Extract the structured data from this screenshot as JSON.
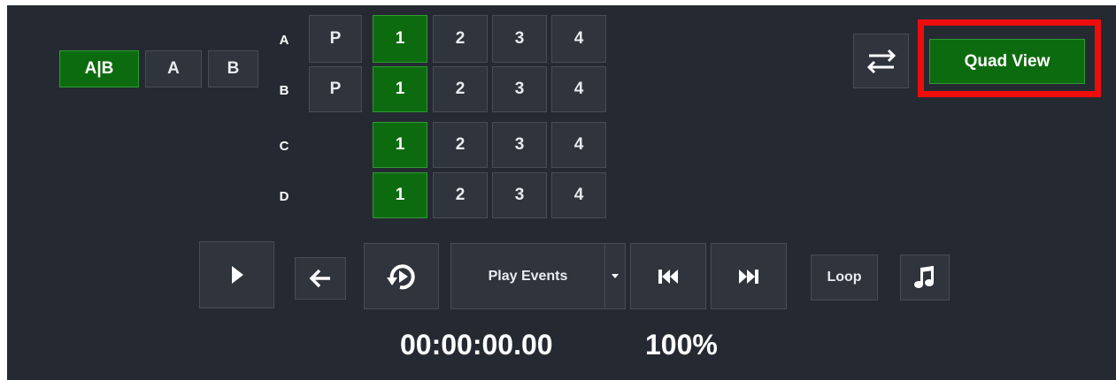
{
  "view_mode": {
    "items": [
      {
        "label": "A|B",
        "active": true
      },
      {
        "label": "A",
        "active": false
      },
      {
        "label": "B",
        "active": false
      }
    ]
  },
  "channels": {
    "rows": [
      {
        "label": "A",
        "preview": "P",
        "slots": [
          "1",
          "2",
          "3",
          "4"
        ],
        "active_slot": "1"
      },
      {
        "label": "B",
        "preview": "P",
        "slots": [
          "1",
          "2",
          "3",
          "4"
        ],
        "active_slot": "1"
      },
      {
        "label": "C",
        "slots": [
          "1",
          "2",
          "3",
          "4"
        ],
        "active_slot": "1"
      },
      {
        "label": "D",
        "slots": [
          "1",
          "2",
          "3",
          "4"
        ],
        "active_slot": "1"
      }
    ]
  },
  "toolbar": {
    "swap_icon": "swap-arrows-icon",
    "quad_view_label": "Quad View",
    "quad_view_active": true
  },
  "transport": {
    "play_icon": "play-icon",
    "back_icon": "arrow-left-icon",
    "replay_icon": "replay-icon",
    "play_events_label": "Play Events",
    "dropdown_icon": "caret-down-icon",
    "skip_back_icon": "skip-back-icon",
    "skip_forward_icon": "skip-forward-icon",
    "loop_label": "Loop",
    "music_icon": "music-note-icon"
  },
  "status": {
    "timecode": "00:00:00.00",
    "speed": "100%"
  },
  "colors": {
    "panel_bg": "#252a32",
    "button_bg": "#2f343d",
    "active_green": "#0d6b0f",
    "highlight_red": "#ee0d0d"
  }
}
